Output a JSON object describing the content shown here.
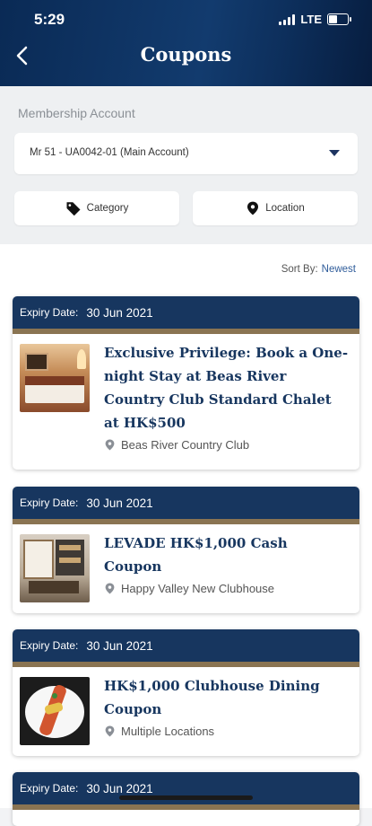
{
  "status": {
    "time": "5:29",
    "network": "LTE"
  },
  "header": {
    "title": "Coupons"
  },
  "membership": {
    "label": "Membership Account",
    "selected": "Mr 51 - UA0042-01 (Main Account)"
  },
  "filters": {
    "category": "Category",
    "location": "Location"
  },
  "sort": {
    "label": "Sort By:",
    "value": "Newest"
  },
  "coupons": [
    {
      "expiry_label": "Expiry Date:",
      "expiry_date": "30 Jun 2021",
      "title": "Exclusive Privilege: Book a One-night Stay at Beas River Country Club Standard Chalet at HK$500",
      "location": "Beas River Country Club"
    },
    {
      "expiry_label": "Expiry Date:",
      "expiry_date": "30 Jun 2021",
      "title": "LEVADE HK$1,000 Cash Coupon",
      "location": "Happy Valley New Clubhouse"
    },
    {
      "expiry_label": "Expiry Date:",
      "expiry_date": "30 Jun 2021",
      "title": "HK$1,000 Clubhouse Dining Coupon",
      "location": "Multiple Locations"
    },
    {
      "expiry_label": "Expiry Date:",
      "expiry_date": "30 Jun 2021"
    }
  ]
}
